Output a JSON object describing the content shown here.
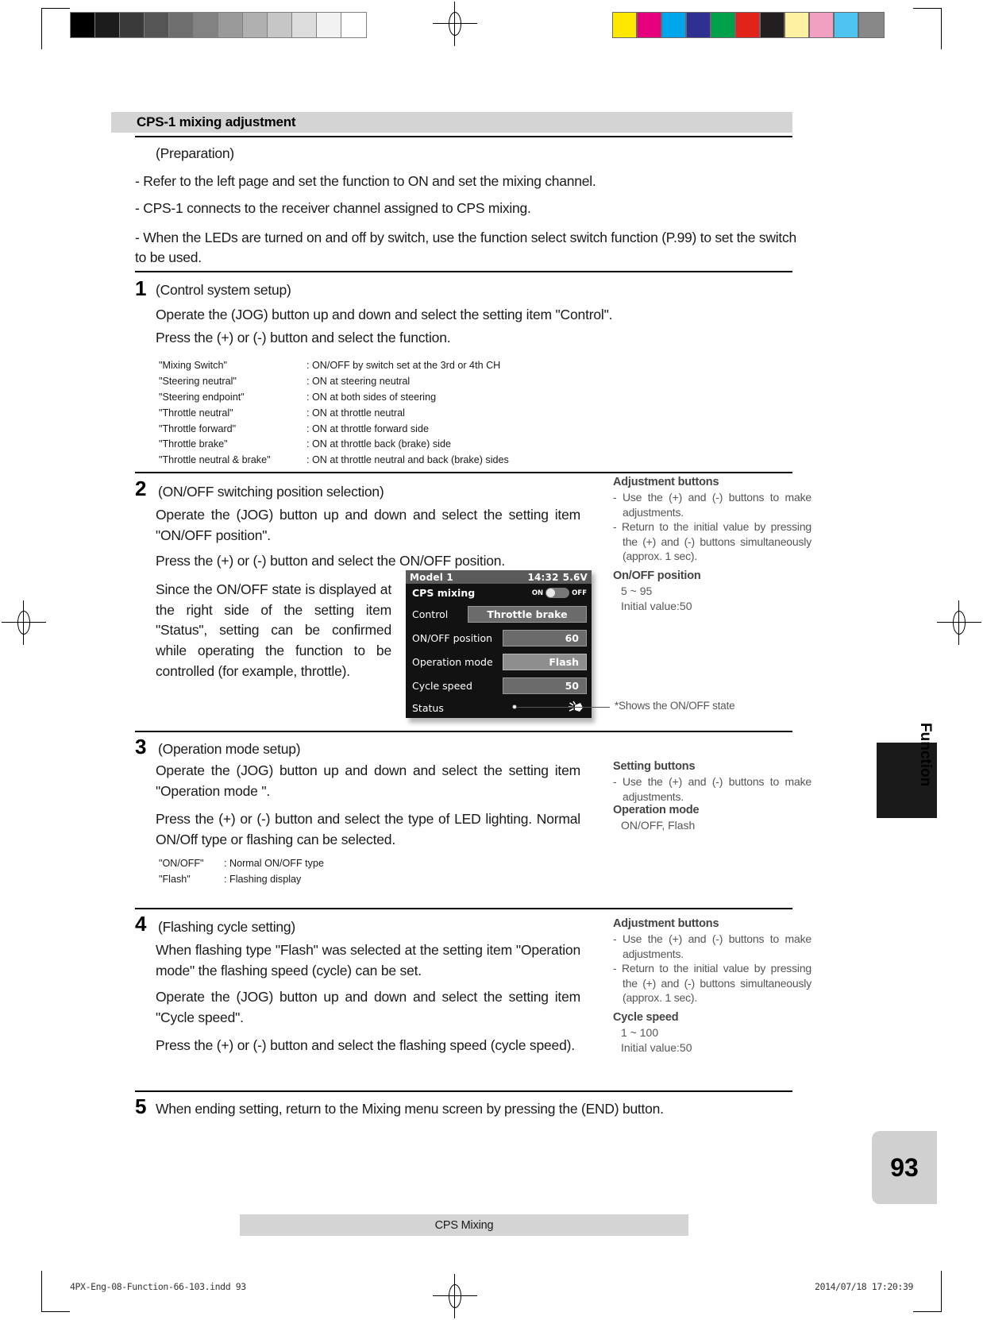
{
  "section": {
    "heading": "CPS-1 mixing adjustment"
  },
  "preparation": {
    "label": "(Preparation)",
    "bullets": [
      "-  Refer to the left page and set the function to ON and set the mixing channel.",
      "-  CPS-1 connects to the receiver channel assigned to CPS mixing.",
      "-  When the LEDs are turned on and off by switch, use the function select  switch function (P.99) to set the switch to be used."
    ]
  },
  "steps": [
    {
      "num": "1",
      "title": "(Control system setup)",
      "paragraphs": [
        "Operate the (JOG) button up and down and select the setting item \"Control\".",
        "Press the (+) or (-) button and select the function."
      ]
    },
    {
      "num": "2",
      "title": "(ON/OFF switching position selection)",
      "paragraphs": [
        "Operate the (JOG) button up and down and select the setting item \"ON/OFF position\".",
        "Press the (+) or (-) button and select the ON/OFF position.",
        "Since the ON/OFF state is displayed at the right side of the setting item \"Status\", setting can be confirmed while operating the function to be controlled (for example, throttle)."
      ]
    },
    {
      "num": "3",
      "title": "(Operation mode setup)",
      "paragraphs": [
        "Operate the (JOG) button up and down and select the setting item \"Operation mode \".",
        "Press the (+) or (-) button and select the type of LED lighting. Normal ON/Off type or flashing can be selected."
      ]
    },
    {
      "num": "4",
      "title": "(Flashing cycle setting)",
      "paragraphs": [
        "When flashing type \"Flash\" was selected at the setting item \"Operation mode\" the flashing speed (cycle) can be set.",
        "Operate the (JOG) button up and down and select the setting item \"Cycle speed\".",
        "Press the (+) or (-) button and select the flashing speed (cycle speed)."
      ]
    },
    {
      "num": "5",
      "title": "When ending setting, return to the Mixing menu screen by pressing the (END) button.",
      "paragraphs": []
    }
  ],
  "control_functions": [
    {
      "key": "\"Mixing Switch\"",
      "value": ": ON/OFF by switch set at the 3rd or 4th CH"
    },
    {
      "key": "\"Steering neutral\"",
      "value": ": ON at steering neutral"
    },
    {
      "key": "\"Steering endpoint\"",
      "value": ": ON at both sides of steering"
    },
    {
      "key": "\"Throttle neutral\"",
      "value": ": ON at throttle neutral"
    },
    {
      "key": "\"Throttle forward\"",
      "value": ": ON at throttle forward side"
    },
    {
      "key": "\"Throttle brake\"",
      "value": ": ON at throttle back (brake) side"
    },
    {
      "key": "\"Throttle neutral & brake\"",
      "value": ": ON at throttle neutral and back (brake) sides"
    }
  ],
  "operation_mode_options": [
    {
      "key": "\"ON/OFF\"",
      "value": ": Normal ON/OFF type"
    },
    {
      "key": "\"Flash\"",
      "value": ": Flashing display"
    }
  ],
  "lcd": {
    "model": "Model 1",
    "time": "14:32",
    "voltage": "5.6V",
    "screen_title": "CPS mixing",
    "toggle_on_label": "ON",
    "toggle_off_label": "OFF",
    "rows": [
      {
        "label": "Control",
        "value": "Throttle brake"
      },
      {
        "label": "ON/OFF position",
        "value": "60"
      },
      {
        "label": "Operation mode",
        "value": "Flash"
      },
      {
        "label": "Cycle speed",
        "value": "50"
      }
    ],
    "status_label": "Status"
  },
  "callout": {
    "text": "*Shows the ON/OFF state"
  },
  "annotations": [
    {
      "heading": "Adjustment buttons",
      "lines": [
        "- Use the (+) and (-) buttons to make adjustments.",
        "- Return to the initial value by pressing the (+) and (-) buttons simultaneously (approx. 1 sec)."
      ],
      "value_heading": "On/OFF position",
      "values": [
        "5 ~ 95",
        "Initial value:50"
      ]
    },
    {
      "heading": "Setting buttons",
      "lines": [
        "- Use the (+) and (-) buttons to make adjustments."
      ],
      "value_heading": "Operation mode",
      "values": [
        "ON/OFF, Flash"
      ]
    },
    {
      "heading": "Adjustment buttons",
      "lines": [
        "- Use the (+) and (-) buttons to make adjustments.",
        "- Return to the initial value by pressing the (+) and (-) buttons simultaneously (approx. 1 sec)."
      ],
      "value_heading": "Cycle speed",
      "values": [
        "1 ~ 100",
        "Initial value:50"
      ]
    }
  ],
  "side_tab": {
    "label": "Function"
  },
  "footer": {
    "band_label": "CPS Mixing",
    "page_number": "93",
    "print_file": "4PX-Eng-08-Function-66-103.indd    93",
    "print_date": "2014/07/18    17:20:39"
  },
  "colors": {
    "gray_bar": [
      "#000000",
      "#1c1c1c",
      "#3a3a3a",
      "#555555",
      "#6e6e6e",
      "#828282",
      "#9a9a9a",
      "#b0b0b0",
      "#c6c6c6",
      "#dcdcdc",
      "#f2f2f2",
      "#ffffff"
    ],
    "color_bar": [
      "#ffe800",
      "#e6007e",
      "#00a6eb",
      "#2e3192",
      "#00a14b",
      "#e2231a",
      "#231f20",
      "#fdf0a0",
      "#f2a0c2",
      "#4dc3f0",
      "#888888"
    ],
    "band": "#d4d4d4",
    "lcd_bg": "#121212"
  }
}
